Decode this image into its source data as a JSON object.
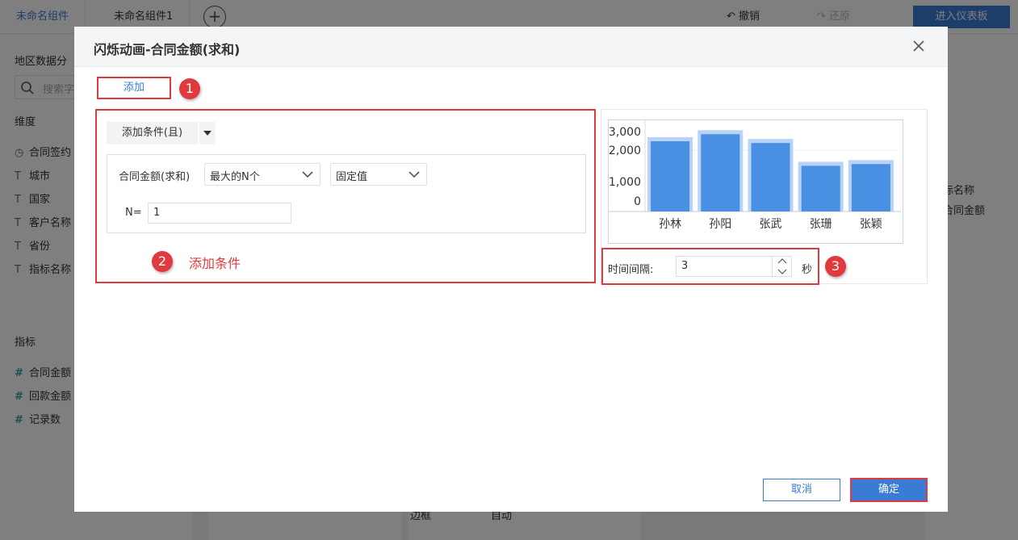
{
  "background": {
    "tabs": [
      "未命名组件",
      "未命名组件1"
    ],
    "undo_label": "撤销",
    "redo_label": "还原",
    "enter_dashboard_label": "进入仪表板",
    "left_panel": {
      "title": "地区数据分",
      "search_placeholder": "搜索字",
      "dimensions_header": "维度",
      "dimensions": [
        {
          "icon": "clock-icon",
          "label": "合同签约"
        },
        {
          "icon": "text-type-icon",
          "label": "城市"
        },
        {
          "icon": "text-type-icon",
          "label": "国家"
        },
        {
          "icon": "text-type-icon",
          "label": "客户名称"
        },
        {
          "icon": "text-type-icon",
          "label": "省份"
        },
        {
          "icon": "text-type-icon",
          "label": "指标名称"
        }
      ],
      "measures_header": "指标",
      "measures": [
        {
          "icon": "hash-icon",
          "label": "合同金额"
        },
        {
          "icon": "hash-icon",
          "label": "回款金额"
        },
        {
          "icon": "hash-icon",
          "label": "记录数"
        }
      ]
    },
    "right_panel_items": [
      "标名称",
      "合同金额"
    ],
    "bottom_label": "边框",
    "bottom_select_value": "自动"
  },
  "dialog": {
    "title": "闪烁动画-合同金额(求和)",
    "add_button": "添加",
    "add_condition_button": "添加条件(且)",
    "condition": {
      "field": "合同金额(求和)",
      "operator": "最大的N个",
      "value_type": "固定值",
      "n_label": "N=",
      "n_value": "1"
    },
    "annotation_add_condition": "添加条件",
    "interval": {
      "label": "时间间隔:",
      "value": "3",
      "unit": "秒"
    },
    "cancel_button": "取消",
    "ok_button": "确定",
    "markers": [
      "1",
      "2",
      "3"
    ]
  },
  "colors": {
    "primary": "#3a7bd5",
    "highlight": "#e0393e",
    "bar": "#4a90e2",
    "bar_glow": "#b8d3f5"
  },
  "chart_data": {
    "type": "bar",
    "categories": [
      "孙林",
      "孙阳",
      "张武",
      "张珊",
      "张颖"
    ],
    "values": [
      2000,
      2200,
      1950,
      1300,
      1350
    ],
    "y_ticks": [
      "3,000",
      "2,000",
      "1,000",
      "0"
    ],
    "ylim": [
      0,
      3000
    ],
    "grid": true
  }
}
